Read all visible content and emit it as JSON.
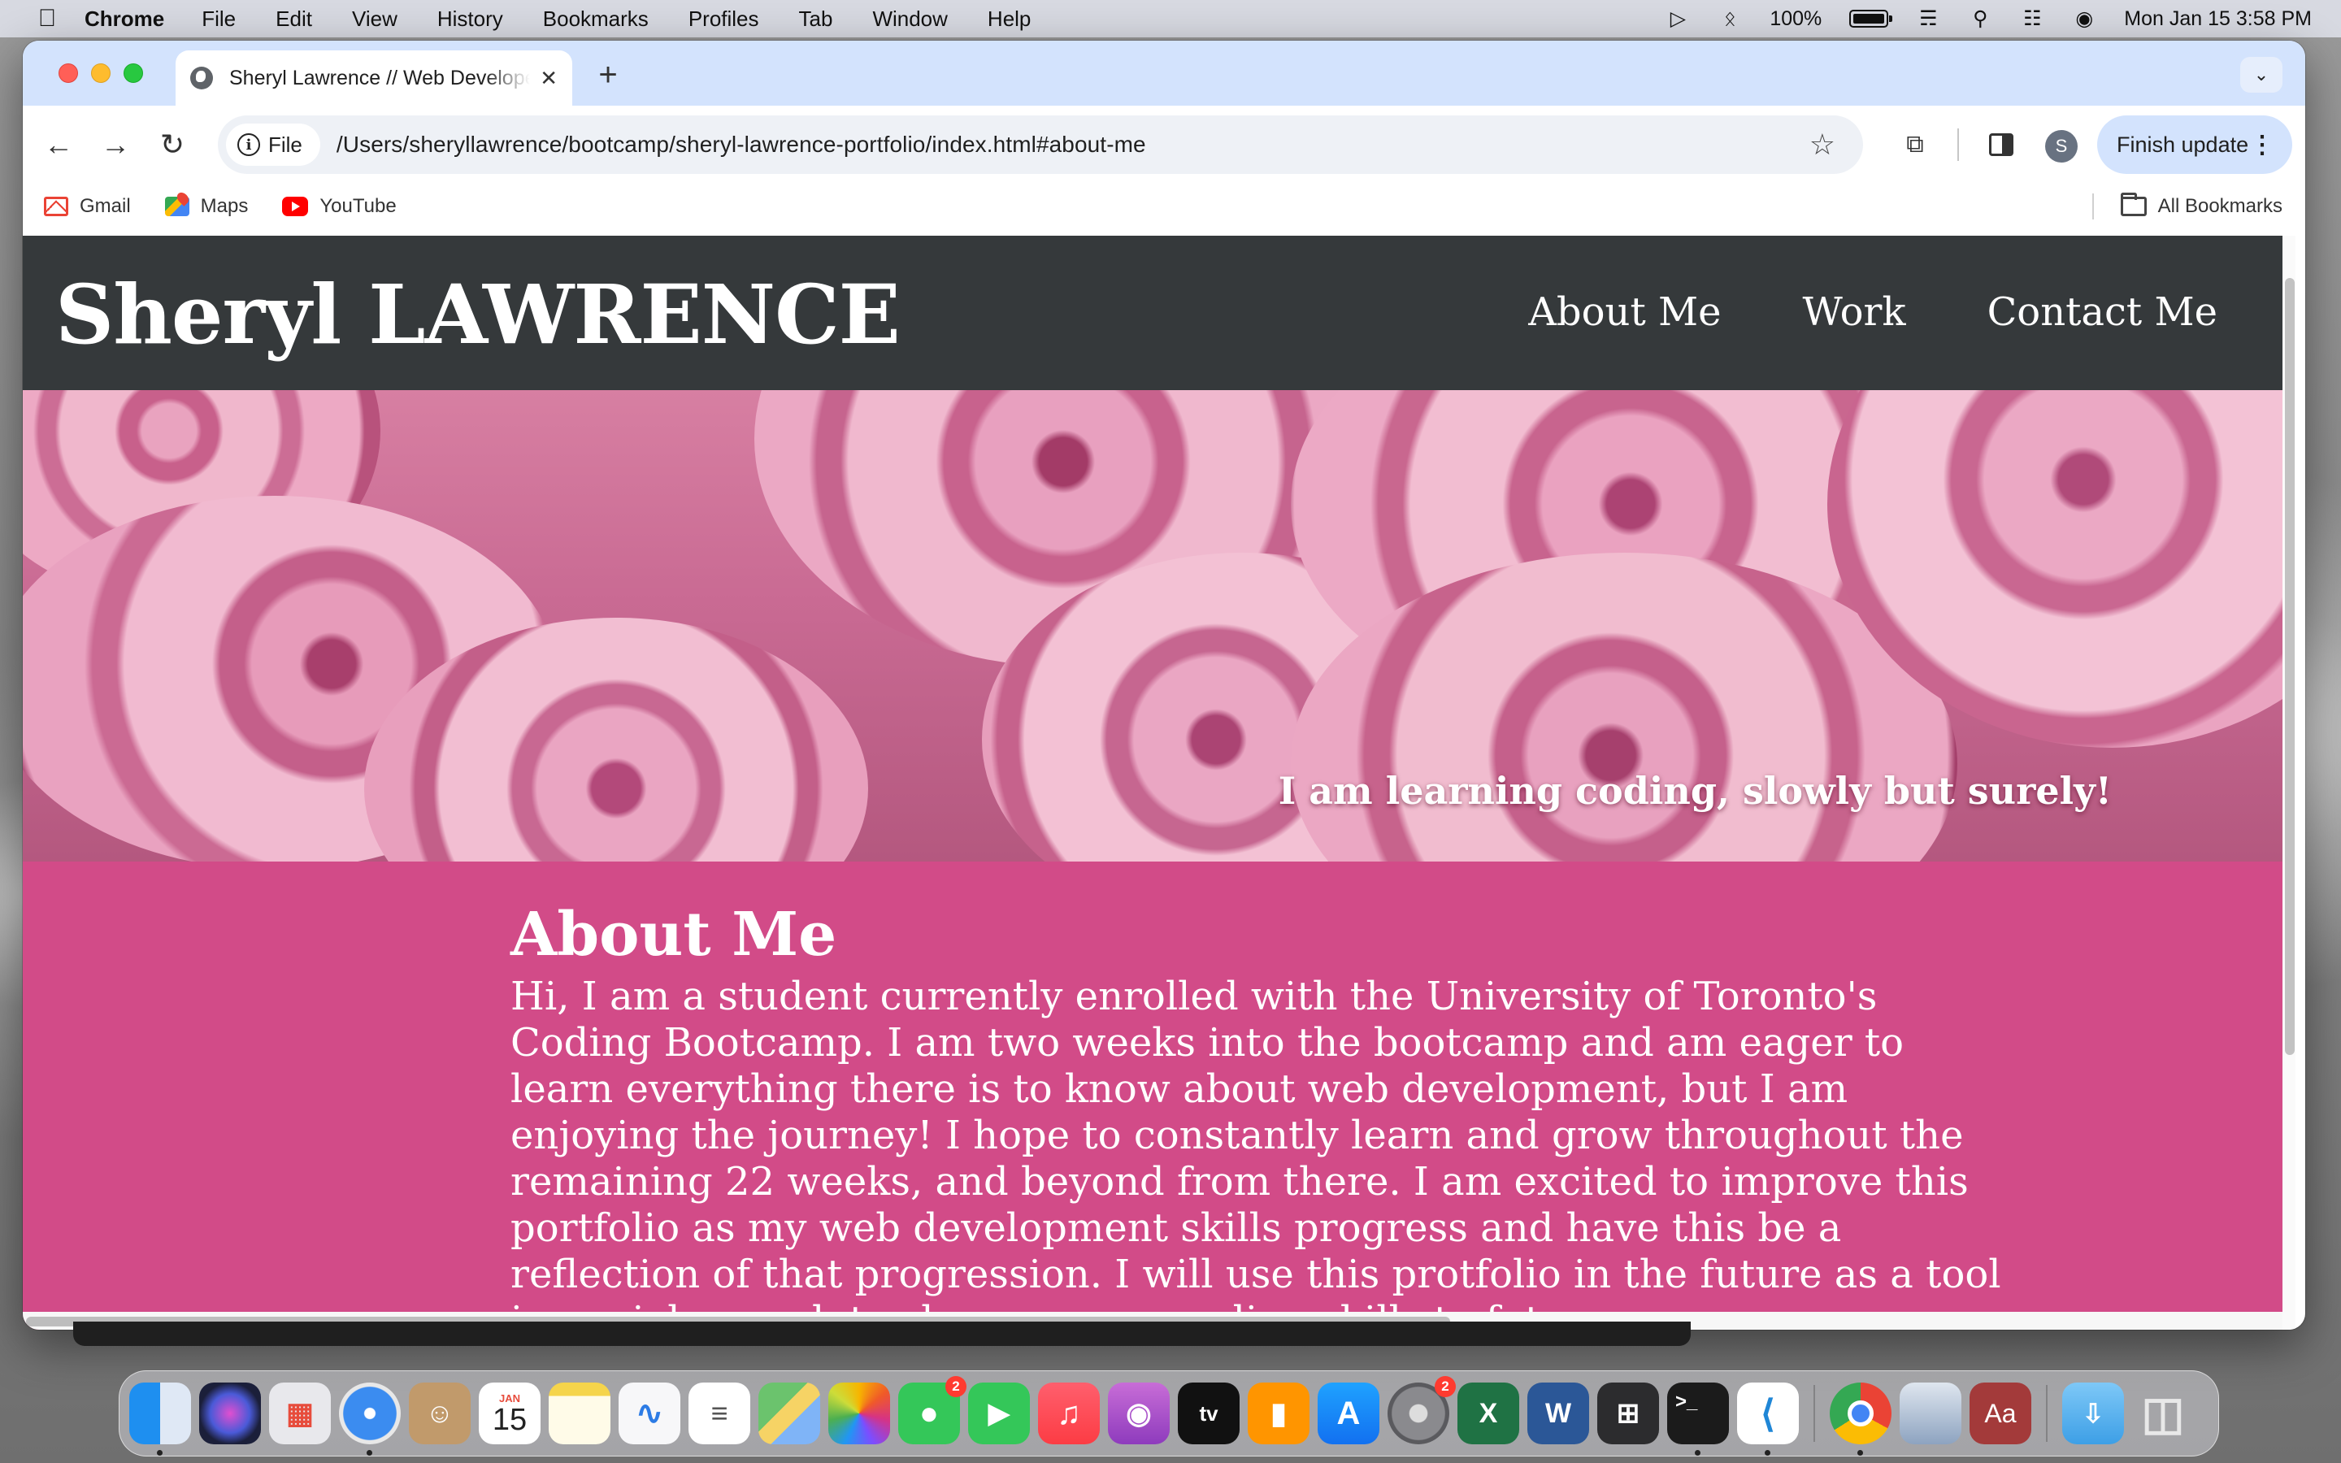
{
  "menubar": {
    "app_name": "Chrome",
    "menus": [
      "File",
      "Edit",
      "View",
      "History",
      "Bookmarks",
      "Profiles",
      "Tab",
      "Window",
      "Help"
    ],
    "battery": "100%",
    "datetime": "Mon Jan 15  3:58 PM"
  },
  "browser": {
    "tab_title": "Sheryl Lawrence // Web Developer",
    "url_scheme_label": "File",
    "url": "/Users/sheryllawrence/bootcamp/sheryl-lawrence-portfolio/index.html#about-me",
    "avatar_letter": "S",
    "update_button": "Finish update",
    "bookmarks": [
      "Gmail",
      "Maps",
      "YouTube"
    ],
    "all_bookmarks": "All Bookmarks"
  },
  "site": {
    "title": "Sheryl LAWRENCE",
    "nav": [
      "About Me",
      "Work",
      "Contact Me"
    ],
    "hero_tagline": "I am learning coding, slowly but surely!",
    "about_heading": "About Me",
    "about_text": "Hi, I am a student currently enrolled with the University of Toronto's Coding Bootcamp. I am two weeks into the bootcamp and am eager to learn everything there is to know about web development, but I am enjoying the journey! I hope to constantly learn and grow throughout the remaining 22 weeks, and beyond from there. I am excited to improve this portfolio as my web development skills progress and have this be a reflection of that progression. I will use this protfolio in the future as a tool in my job search to showcase my coding skills to future"
  },
  "colors": {
    "header_bg": "#35393b",
    "about_bg": "#d24b88",
    "tabstrip_bg": "#d3e3fd"
  },
  "dock": {
    "calendar_month": "JAN",
    "calendar_day": "15",
    "messages_badge": "2",
    "settings_badge": "2",
    "tv_label": "tv",
    "word_label": "W",
    "dictionary_label": "Aa"
  }
}
